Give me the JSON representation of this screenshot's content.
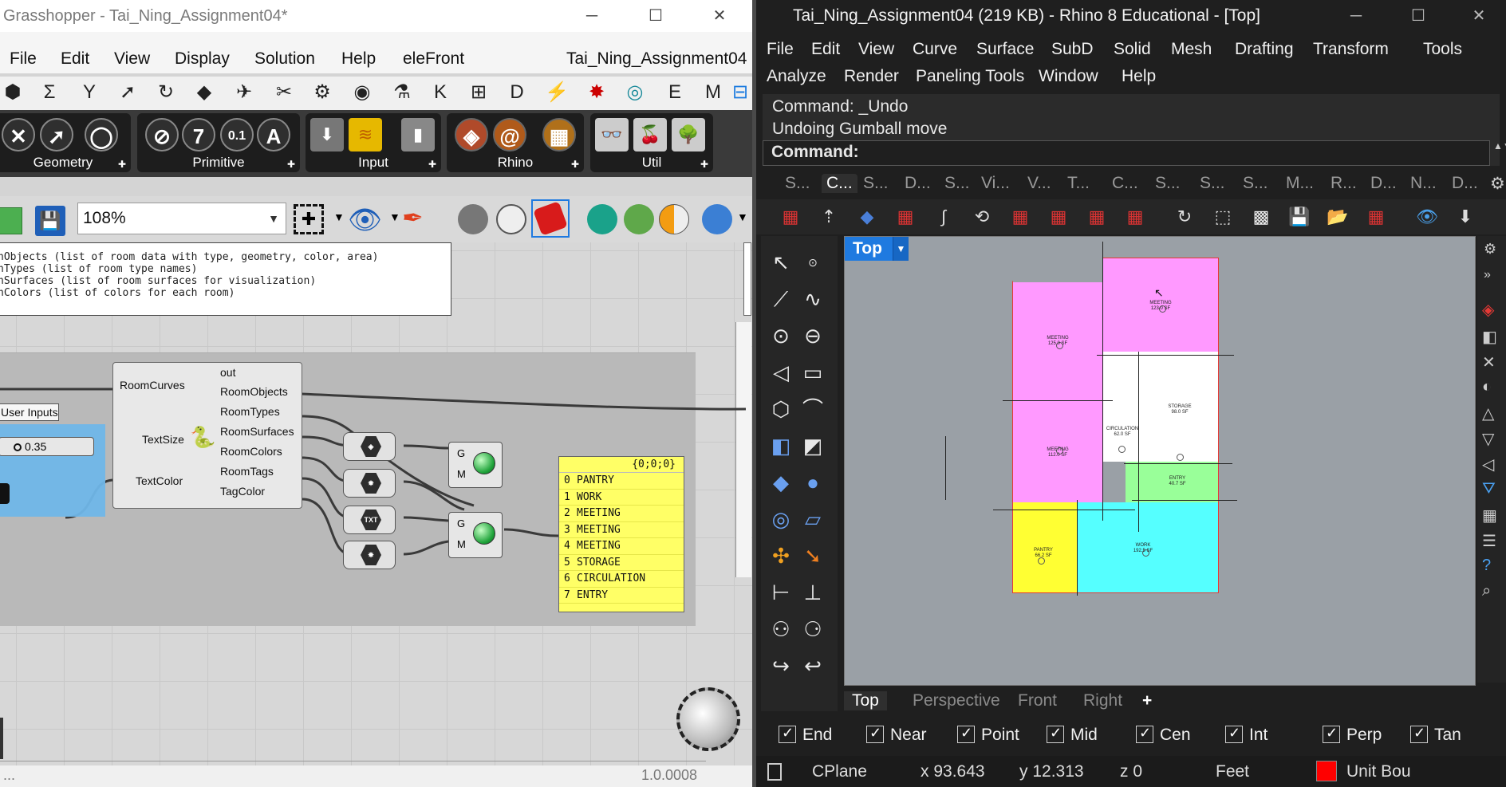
{
  "grasshopper": {
    "title": "Grasshopper - Tai_Ning_Assignment04*",
    "window_controls": {
      "minimize": "─",
      "maximize": "☐",
      "close": "✕"
    },
    "menu": [
      "File",
      "Edit",
      "View",
      "Display",
      "Solution",
      "Help",
      "eleFront"
    ],
    "doc_name": "Tai_Ning_Assignment04",
    "tab_icons": [
      "⬢",
      "Σ",
      "Y",
      "➚",
      "↻",
      "◆",
      "✈",
      "✂",
      "⚙",
      "◉",
      "⚗",
      "K",
      "⊞",
      "D",
      "⚡",
      "✸",
      "◎",
      "E",
      "M",
      "⊟"
    ],
    "ribbon_groups": [
      {
        "label": "Geometry"
      },
      {
        "label": "Primitive"
      },
      {
        "label": "Input"
      },
      {
        "label": "Rhino"
      },
      {
        "label": "Util"
      }
    ],
    "ribbon_glyphs": {
      "primitive": [
        "7",
        "0.1",
        "A"
      ]
    },
    "zoom": "108%",
    "panel_text": "nObjects (list of room data with type, geometry, color, area)\nnTypes (list of room type names)\nnSurfaces (list of room surfaces for visualization)\nnColors (list of colors for each room)",
    "python_component": {
      "inputs": [
        "RoomCurves",
        "TextSize",
        "TextColor"
      ],
      "outputs": [
        "out",
        "RoomObjects",
        "RoomTypes",
        "RoomSurfaces",
        "RoomColors",
        "RoomTags",
        "TagColor"
      ]
    },
    "user_inputs_label": "User Inputs",
    "slider_value": "0.35",
    "small_component_glyphs": [
      "TXT"
    ],
    "preview_pins": {
      "g": "G",
      "m": "M"
    },
    "yellow_panel": {
      "header": "{0;0;0}",
      "items": [
        {
          "index": "0",
          "value": "PANTRY"
        },
        {
          "index": "1",
          "value": "WORK"
        },
        {
          "index": "2",
          "value": "MEETING"
        },
        {
          "index": "3",
          "value": "MEETING"
        },
        {
          "index": "4",
          "value": "MEETING"
        },
        {
          "index": "5",
          "value": "STORAGE"
        },
        {
          "index": "6",
          "value": "CIRCULATION"
        },
        {
          "index": "7",
          "value": "ENTRY"
        }
      ]
    },
    "bottom_left": "...",
    "version": "1.0.0008"
  },
  "rhino": {
    "title": "Tai_Ning_Assignment04 (219 KB) - Rhino 8 Educational - [Top]",
    "window_controls": {
      "minimize": "─",
      "maximize": "☐",
      "close": "✕"
    },
    "menu_row1": [
      "File",
      "Edit",
      "View",
      "Curve",
      "Surface",
      "SubD",
      "Solid",
      "Mesh",
      "Drafting",
      "Transform",
      "Tools"
    ],
    "menu_row2": [
      "Analyze",
      "Render",
      "Paneling Tools",
      "Window",
      "Help"
    ],
    "command_history": [
      "Command: _Undo",
      "Undoing Gumball move"
    ],
    "command_prompt": "Command:",
    "toolbar_tabs": [
      "S...",
      "C...",
      "S...",
      "D...",
      "S...",
      "Vi...",
      "V...",
      "T...",
      "C...",
      "S...",
      "S...",
      "S...",
      "M...",
      "R...",
      "D...",
      "N...",
      "D..."
    ],
    "active_toolbar_tab": 1,
    "viewport": {
      "name": "Top",
      "rooms": [
        {
          "label": "MEETING\n125.0 SF",
          "color": "#ff99ff"
        },
        {
          "label": "MEETING\n123.0 SF",
          "color": "#ff99ff"
        },
        {
          "label": "MEETING\n112.0 SF",
          "color": "#ff99ff"
        },
        {
          "label": "STORAGE\n98.0 SF",
          "color": "#ffffff"
        },
        {
          "label": "CIRCULATION\n62.0 SF",
          "color": "#ffffff"
        },
        {
          "label": "ENTRY\n40.7 SF",
          "color": "#99ff99"
        },
        {
          "label": "PANTRY\n66.2 SF",
          "color": "#ffff33"
        },
        {
          "label": "WORK\n192.5 SF",
          "color": "#55ffff"
        }
      ]
    },
    "viewport_tabs": [
      "Top",
      "Perspective",
      "Front",
      "Right"
    ],
    "add_tab": "+",
    "osnaps": [
      "End",
      "Near",
      "Point",
      "Mid",
      "Cen",
      "Int",
      "Perp",
      "Tan"
    ],
    "status": {
      "cplane": "CPlane",
      "x": "x 93.643",
      "y": "y 12.313",
      "z": "z 0",
      "units": "Feet",
      "layer": "Unit Bou",
      "layer_color": "#ff0000"
    }
  }
}
